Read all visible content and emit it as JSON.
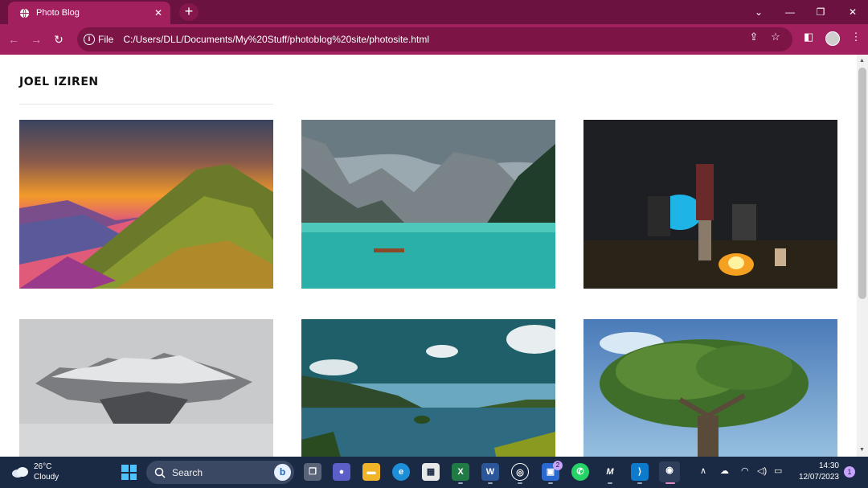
{
  "browser": {
    "tab_title": "Photo Blog",
    "new_tab_label": "+",
    "scheme_label": "File",
    "url": "C:/Users/DLL/Documents/My%20Stuff/photoblog%20site/photosite.html",
    "icons": [
      "globe-icon",
      "close-icon",
      "back-icon",
      "forward-icon",
      "reload-icon",
      "info-icon",
      "share-icon",
      "star-icon",
      "sidepanel-icon",
      "profile-avatar",
      "menu-icon",
      "chevron-down-icon",
      "minimize-icon",
      "restore-icon",
      "window-close-icon"
    ]
  },
  "site": {
    "title": "JOEL IZIREN",
    "photos": [
      {
        "name": "photo-mountain-sunset"
      },
      {
        "name": "photo-lake-mountains"
      },
      {
        "name": "photo-campfire"
      },
      {
        "name": "photo-snowy-peaks"
      },
      {
        "name": "photo-lake-island"
      },
      {
        "name": "photo-tree"
      }
    ]
  },
  "taskbar": {
    "weather_temp": "26°C",
    "weather_cond": "Cloudy",
    "search_label": "Search",
    "chat_badge": "2",
    "time": "14:30",
    "date": "12/07/2023",
    "notification_count": "1"
  },
  "colors": {
    "tab_bar": "#6b1240",
    "toolbar": "#a3205e",
    "omnibox": "#7d1446",
    "taskbar": "#1b2a44"
  }
}
